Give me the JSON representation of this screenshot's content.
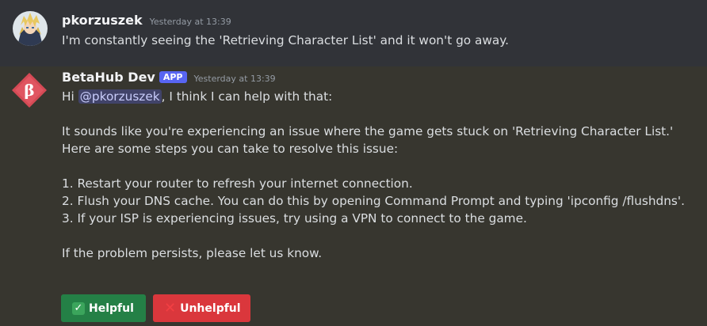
{
  "messages": {
    "user": {
      "username": "pkorzuszek",
      "timestamp": "Yesterday at 13:39",
      "text": "I'm constantly seeing the 'Retrieving Character List' and it won't go away."
    },
    "bot": {
      "username": "BetaHub Dev",
      "badge": "APP",
      "timestamp": "Yesterday at 13:39",
      "greeting_prefix": "Hi ",
      "mention": "@pkorzuszek",
      "greeting_suffix": ", I think I can help with that:",
      "para1_line1": "It sounds like you're experiencing an issue where the game gets stuck on 'Retrieving Character List.'",
      "para1_line2": "Here are some steps you can take to resolve this issue:",
      "step1": "1. Restart your router to refresh your internet connection.",
      "step2": "2. Flush your DNS cache. You can do this by opening Command Prompt and typing 'ipconfig /flushdns'.",
      "step3": "3. If your ISP is experiencing issues, try using a VPN to connect to the game.",
      "closing": "If the problem persists, please let us know."
    }
  },
  "buttons": {
    "helpful": {
      "label": "Helpful",
      "icon": "check-mark-icon",
      "color": "#248046"
    },
    "unhelpful": {
      "label": "Unhelpful",
      "icon": "cross-mark-icon",
      "color": "#da373c"
    }
  },
  "colors": {
    "background": "#313338",
    "bot_message_highlight": "#37362f",
    "app_badge": "#5865f2",
    "mention_text": "#c9cdfb"
  }
}
